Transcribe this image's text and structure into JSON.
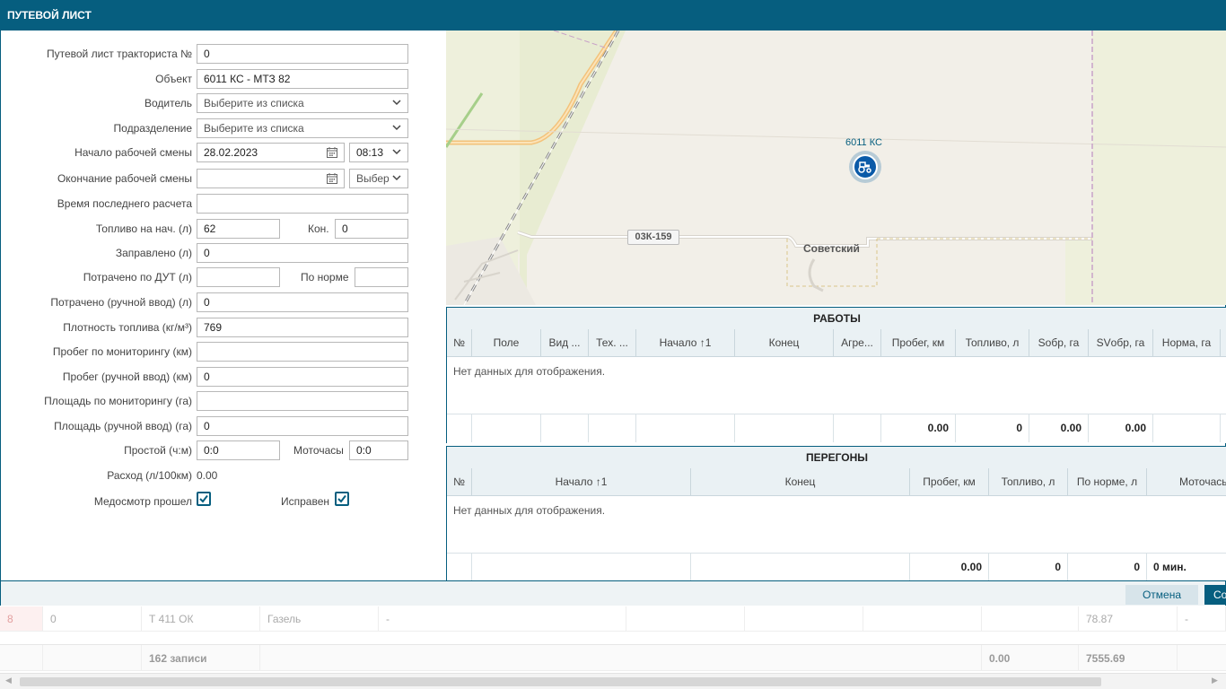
{
  "dialog": {
    "title": "ПУТЕВОЙ ЛИСТ"
  },
  "form": {
    "waybill_label": "Путевой лист тракториста №",
    "waybill_value": "0",
    "object_label": "Объект",
    "object_value": "6011 КС - МТЗ 82",
    "driver_label": "Водитель",
    "driver_value": "Выберите из списка",
    "division_label": "Подразделение",
    "division_value": "Выберите из списка",
    "shift_start_label": "Начало рабочей смены",
    "shift_start_date": "28.02.2023",
    "shift_start_time": "08:13",
    "shift_end_label": "Окончание рабочей смены",
    "shift_end_date": "",
    "shift_end_time": "Выбер",
    "last_calc_label": "Время последнего расчета",
    "last_calc_value": "",
    "fuel_start_label": "Топливо на нач. (л)",
    "fuel_start_value": "62",
    "fuel_end_label": "Кон.",
    "fuel_end_value": "0",
    "refueled_label": "Заправлено (л)",
    "refueled_value": "0",
    "spent_dut_label": "Потрачено по ДУТ (л)",
    "spent_dut_value": "",
    "norm_label": "По норме",
    "norm_value": "",
    "spent_manual_label": "Потрачено (ручной ввод) (л)",
    "spent_manual_value": "0",
    "density_label": "Плотность топлива (кг/м³)",
    "density_value": "769",
    "mileage_mon_label": "Пробег по мониторингу (км)",
    "mileage_mon_value": "",
    "mileage_manual_label": "Пробег (ручной ввод) (км)",
    "mileage_manual_value": "0",
    "area_mon_label": "Площадь по мониторингу (га)",
    "area_mon_value": "",
    "area_manual_label": "Площадь (ручной ввод) (га)",
    "area_manual_value": "0",
    "idle_label": "Простой (ч:м)",
    "idle_value": "0:0",
    "moto_label": "Моточасы",
    "moto_value": "0:0",
    "consumption_label": "Расход (л/100км)",
    "consumption_value": "0.00",
    "medcheck_label": "Медосмотр прошел",
    "medcheck_checked": true,
    "serviceable_label": "Исправен",
    "serviceable_checked": true
  },
  "map": {
    "vehicle_label": "6011 КС",
    "road_label": "03К-159",
    "town_label": "Советский"
  },
  "works": {
    "title": "РАБОТЫ",
    "columns": [
      "№",
      "Поле",
      "Вид ...",
      "Тех. ...",
      "Начало ↑1",
      "Конец",
      "Агре...",
      "Пробег, км",
      "Топливо, л",
      "Sобр, га",
      "SVобр, га",
      "Норма, га"
    ],
    "empty_text": "Нет данных для отображения.",
    "totals": {
      "mileage": "0.00",
      "fuel": "0",
      "s_obr": "0.00",
      "sv_obr": "0.00"
    }
  },
  "transfers": {
    "title": "ПЕРЕГОНЫ",
    "columns": [
      "№",
      "Начало ↑1",
      "Конец",
      "Пробег, км",
      "Топливо, л",
      "По норме, л",
      "Моточасы"
    ],
    "empty_text": "Нет данных для отображения.",
    "totals": {
      "mileage": "0.00",
      "fuel": "0",
      "norm": "0",
      "moto": "0 мин."
    }
  },
  "actions": {
    "cancel": "Отмена",
    "save": "Со"
  },
  "background": {
    "row1": [
      "8",
      "0",
      "Т 411 ОК",
      "Газель",
      "-",
      "78.87",
      "-"
    ],
    "footer": {
      "count": "162 записи",
      "sum1": "0.00",
      "sum2": "7555.69"
    }
  }
}
